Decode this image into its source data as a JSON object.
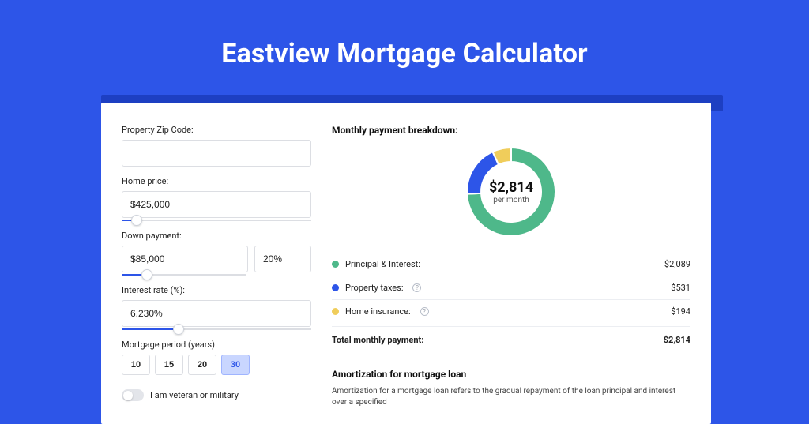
{
  "title": "Eastview Mortgage Calculator",
  "form": {
    "zip": {
      "label": "Property Zip Code:",
      "value": ""
    },
    "home_price": {
      "label": "Home price:",
      "value": "$425,000",
      "slider_pct": 8
    },
    "down_payment": {
      "label": "Down payment:",
      "amount": "$85,000",
      "percent": "20%",
      "slider_pct": 20
    },
    "interest": {
      "label": "Interest rate (%):",
      "value": "6.230%",
      "slider_pct": 30
    },
    "period": {
      "label": "Mortgage period (years):",
      "options": [
        "10",
        "15",
        "20",
        "30"
      ],
      "active": 3
    },
    "veteran": {
      "label": "I am veteran or military",
      "on": false
    }
  },
  "breakdown": {
    "title": "Monthly payment breakdown:",
    "center_amount": "$2,814",
    "center_sub": "per month",
    "rows": [
      {
        "label": "Principal & Interest:",
        "value": "$2,089",
        "color": "green",
        "info": false
      },
      {
        "label": "Property taxes:",
        "value": "$531",
        "color": "blue",
        "info": true
      },
      {
        "label": "Home insurance:",
        "value": "$194",
        "color": "yellow",
        "info": true
      }
    ],
    "total_label": "Total monthly payment:",
    "total_value": "$2,814"
  },
  "amort": {
    "title": "Amortization for mortgage loan",
    "text": "Amortization for a mortgage loan refers to the gradual repayment of the loan principal and interest over a specified"
  },
  "chart_data": {
    "type": "pie",
    "title": "Monthly payment breakdown",
    "series": [
      {
        "name": "Principal & Interest",
        "value": 2089,
        "color": "#4eb88a"
      },
      {
        "name": "Property taxes",
        "value": 531,
        "color": "#2d55e8"
      },
      {
        "name": "Home insurance",
        "value": 194,
        "color": "#f0cd5b"
      }
    ],
    "total": 2814,
    "center_label": "$2,814 per month"
  }
}
